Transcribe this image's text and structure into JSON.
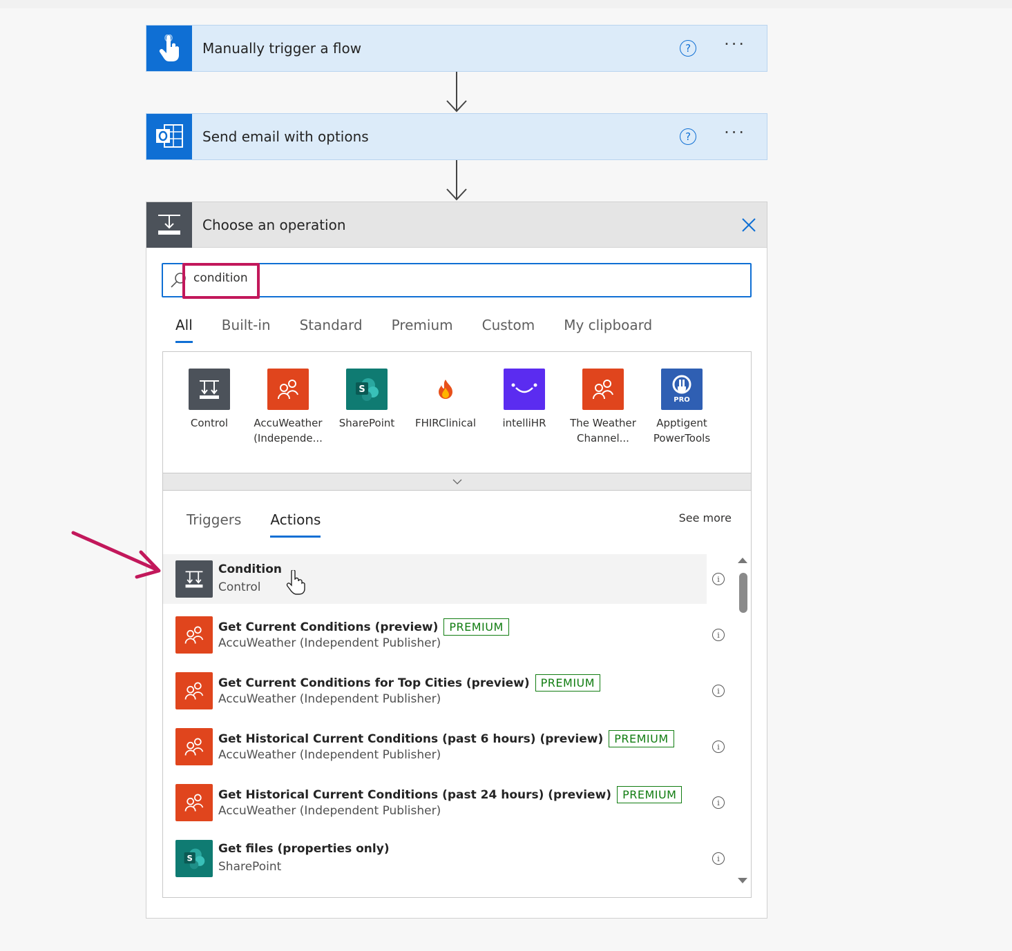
{
  "steps": [
    {
      "title": "Manually trigger a flow",
      "help": "?",
      "menu": "···"
    },
    {
      "title": "Send email with options",
      "help": "?",
      "menu": "···"
    }
  ],
  "panel": {
    "title": "Choose an operation",
    "search_value": "condition",
    "tabs": [
      "All",
      "Built-in",
      "Standard",
      "Premium",
      "Custom",
      "My clipboard"
    ],
    "connectors": [
      {
        "label": "Control",
        "color": "#4c525a",
        "icon": "control-icon"
      },
      {
        "label": "AccuWeather (Independe...",
        "color": "#e0451d",
        "icon": "accuweather-icon"
      },
      {
        "label": "SharePoint",
        "color": "#0f7b72",
        "icon": "sharepoint-icon"
      },
      {
        "label": "FHIRClinical",
        "color": "#ffffff",
        "icon": "fhir-flame-icon"
      },
      {
        "label": "intelliHR",
        "color": "#5b2cf0",
        "icon": "intellihr-icon"
      },
      {
        "label": "The Weather Channel...",
        "color": "#e0451d",
        "icon": "weather-channel-icon"
      },
      {
        "label": "Apptigent PowerTools",
        "color": "#2f5fb3",
        "icon": "apptigent-icon",
        "badge": "PRO"
      }
    ],
    "subtabs": [
      "Triggers",
      "Actions"
    ],
    "see_more": "See more",
    "premium_label": "PREMIUM",
    "results": [
      {
        "title": "Condition",
        "sub": "Control",
        "premium": false,
        "color": "#4c525a",
        "icon": "control-icon"
      },
      {
        "title": "Get Current Conditions (preview)",
        "sub": "AccuWeather (Independent Publisher)",
        "premium": true,
        "color": "#e0451d",
        "icon": "accuweather-icon"
      },
      {
        "title": "Get Current Conditions for Top Cities (preview)",
        "sub": "AccuWeather (Independent Publisher)",
        "premium": true,
        "color": "#e0451d",
        "icon": "accuweather-icon"
      },
      {
        "title": "Get Historical Current Conditions (past 6 hours) (preview)",
        "sub": "AccuWeather (Independent Publisher)",
        "premium": true,
        "color": "#e0451d",
        "icon": "accuweather-icon"
      },
      {
        "title": "Get Historical Current Conditions (past 24 hours) (preview)",
        "sub": "AccuWeather (Independent Publisher)",
        "premium": true,
        "color": "#e0451d",
        "icon": "accuweather-icon"
      },
      {
        "title": "Get files (properties only)",
        "sub": "SharePoint",
        "premium": false,
        "color": "#0f7b72",
        "icon": "sharepoint-icon"
      }
    ]
  },
  "colors": {
    "accent": "#0f6fd4",
    "premium": "#107c10",
    "annotation": "#c2185b"
  }
}
